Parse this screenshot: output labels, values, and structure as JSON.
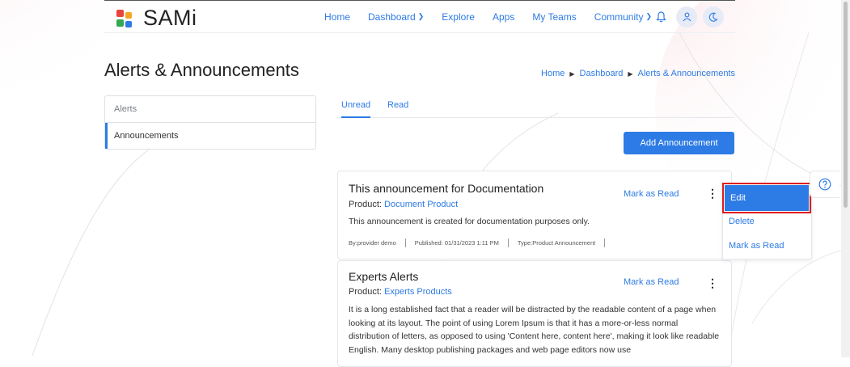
{
  "brand": {
    "name": "SAMi"
  },
  "nav": {
    "items": [
      {
        "label": "Home"
      },
      {
        "label": "Dashboard",
        "chevron": true
      },
      {
        "label": "Explore"
      },
      {
        "label": "Apps"
      },
      {
        "label": "My Teams"
      },
      {
        "label": "Community",
        "chevron": true
      }
    ],
    "icons": [
      "bell-icon",
      "user-icon",
      "moon-icon"
    ]
  },
  "page": {
    "title": "Alerts & Announcements"
  },
  "breadcrumb": [
    "Home",
    "Dashboard",
    "Alerts & Announcements"
  ],
  "sidebar": {
    "items": [
      {
        "label": "Alerts"
      },
      {
        "label": "Announcements",
        "active": true
      }
    ]
  },
  "tabs": [
    {
      "label": "Unread",
      "active": true
    },
    {
      "label": "Read"
    }
  ],
  "actions": {
    "add_announcement": "Add Announcement"
  },
  "announcements": [
    {
      "title": "This announcement for Documentation",
      "product_label": "Product:",
      "product": "Document Product",
      "description": "This announcement is created for documentation purposes only.",
      "by": "By:provider demo",
      "published": "Published: 01/31/2023 1:11 PM",
      "type": "Type:Product Announcement",
      "mark_read": "Mark as Read"
    },
    {
      "title": "Experts Alerts",
      "product_label": "Product:",
      "product": "Experts Products",
      "body": "It is a long established fact that a reader will be distracted by the readable content of a page when looking at its layout. The point of using Lorem Ipsum is that it has a more-or-less normal distribution of letters, as opposed to using 'Content here, content here', making it look like readable English. Many desktop publishing packages and web page editors now use",
      "mark_read": "Mark as Read"
    }
  ],
  "dropdown": {
    "items": [
      {
        "label": "Edit",
        "highlighted": true
      },
      {
        "label": "Delete"
      },
      {
        "label": "Mark as Read"
      }
    ]
  },
  "colors": {
    "accent": "#2d7be5",
    "highlight_outline": "#e11b1b"
  },
  "help": {
    "icon": "help-icon"
  }
}
